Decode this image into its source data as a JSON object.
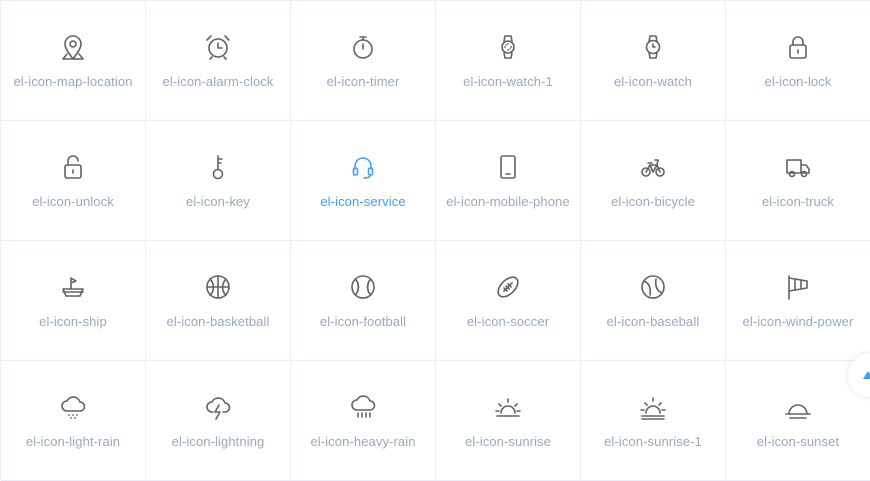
{
  "accent_color": "#409eff",
  "icon_color": "#606266",
  "label_color": "#99a9bf",
  "icons": [
    {
      "name": "el-icon-map-location",
      "icon": "map-location-icon"
    },
    {
      "name": "el-icon-alarm-clock",
      "icon": "alarm-clock-icon"
    },
    {
      "name": "el-icon-timer",
      "icon": "timer-icon"
    },
    {
      "name": "el-icon-watch-1",
      "icon": "watch-1-icon"
    },
    {
      "name": "el-icon-watch",
      "icon": "watch-icon"
    },
    {
      "name": "el-icon-lock",
      "icon": "lock-icon"
    },
    {
      "name": "el-icon-unlock",
      "icon": "unlock-icon"
    },
    {
      "name": "el-icon-key",
      "icon": "key-icon"
    },
    {
      "name": "el-icon-service",
      "icon": "service-icon"
    },
    {
      "name": "el-icon-mobile-phone",
      "icon": "mobile-phone-icon"
    },
    {
      "name": "el-icon-bicycle",
      "icon": "bicycle-icon"
    },
    {
      "name": "el-icon-truck",
      "icon": "truck-icon"
    },
    {
      "name": "el-icon-ship",
      "icon": "ship-icon"
    },
    {
      "name": "el-icon-basketball",
      "icon": "basketball-icon"
    },
    {
      "name": "el-icon-football",
      "icon": "football-icon"
    },
    {
      "name": "el-icon-soccer",
      "icon": "soccer-icon"
    },
    {
      "name": "el-icon-baseball",
      "icon": "baseball-icon"
    },
    {
      "name": "el-icon-wind-power",
      "icon": "wind-power-icon"
    },
    {
      "name": "el-icon-light-rain",
      "icon": "light-rain-icon"
    },
    {
      "name": "el-icon-lightning",
      "icon": "lightning-icon"
    },
    {
      "name": "el-icon-heavy-rain",
      "icon": "heavy-rain-icon"
    },
    {
      "name": "el-icon-sunrise",
      "icon": "sunrise-icon"
    },
    {
      "name": "el-icon-sunrise-1",
      "icon": "sunrise-1-icon"
    },
    {
      "name": "el-icon-sunset",
      "icon": "sunset-icon"
    }
  ],
  "hovered_index": 8,
  "back_to_top": {
    "icon": "caret-top-icon"
  }
}
